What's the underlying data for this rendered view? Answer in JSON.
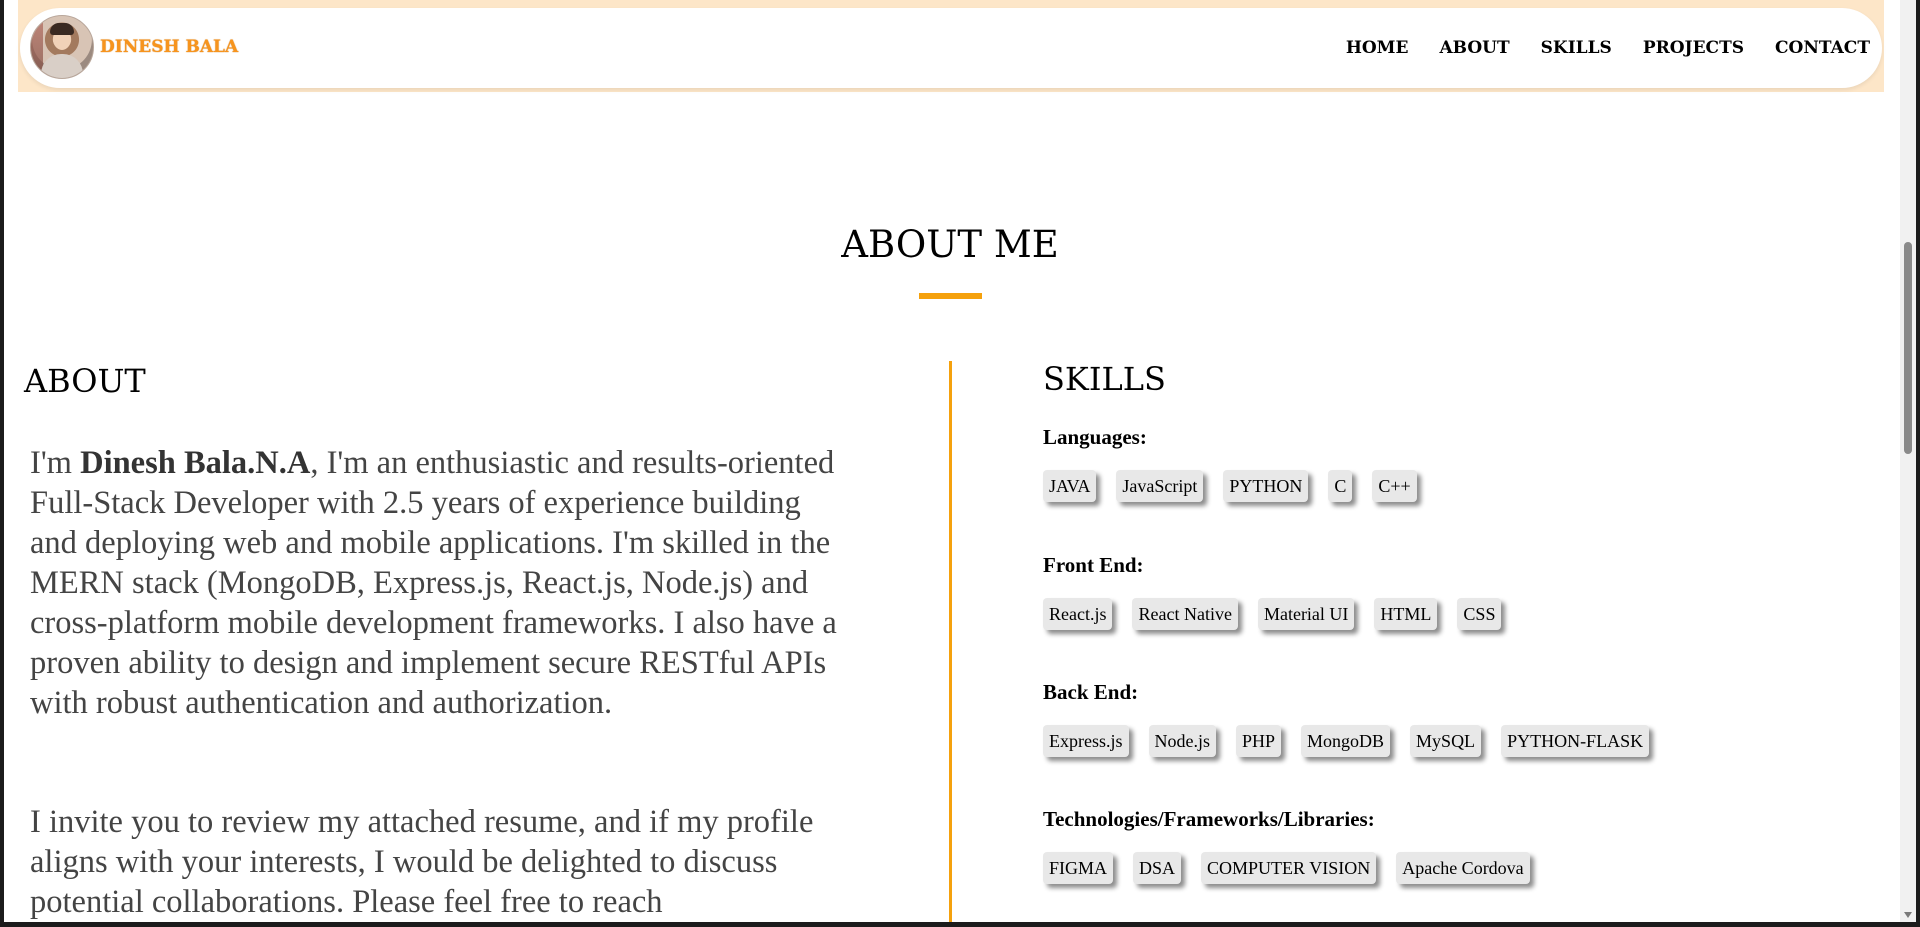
{
  "header": {
    "brand": "DINESH BALA",
    "nav": [
      "HOME",
      "ABOUT",
      "SKILLS",
      "PROJECTS",
      "CONTACT"
    ]
  },
  "section": {
    "title": "ABOUT ME"
  },
  "about": {
    "heading": "ABOUT",
    "intro_prefix": "I'm ",
    "name": "Dinesh Bala.N.A",
    "intro_rest": ", I'm an enthusiastic and results-oriented Full-Stack Developer with 2.5 years of experience building and deploying web and mobile applications. I'm skilled in the MERN stack (MongoDB, Express.js, React.js, Node.js) and cross-platform mobile development frameworks. I also have a proven ability to design and implement secure RESTful APIs with robust authentication and authorization.",
    "paragraph2": "I invite you to review my attached resume, and if my profile aligns with your interests, I would be delighted to discuss potential collaborations. Please feel free to reach"
  },
  "skills": {
    "heading": "SKILLS",
    "groups": [
      {
        "label": "Languages:",
        "items": [
          "JAVA",
          "JavaScript",
          "PYTHON",
          "C",
          "C++"
        ]
      },
      {
        "label": "Front End:",
        "items": [
          "React.js",
          "React Native",
          "Material UI",
          "HTML",
          "CSS"
        ]
      },
      {
        "label": "Back End:",
        "items": [
          "Express.js",
          "Node.js",
          "PHP",
          "MongoDB",
          "MySQL",
          "PYTHON-FLASK"
        ]
      },
      {
        "label": "Technologies/Frameworks/Libraries:",
        "items": [
          "FIGMA",
          "DSA",
          "COMPUTER VISION",
          "Apache Cordova"
        ]
      }
    ]
  },
  "colors": {
    "accent": "#f5a10d",
    "brand": "#f7941d",
    "header_band": "#fde6c8",
    "chip_bg": "#e8e8e8"
  }
}
